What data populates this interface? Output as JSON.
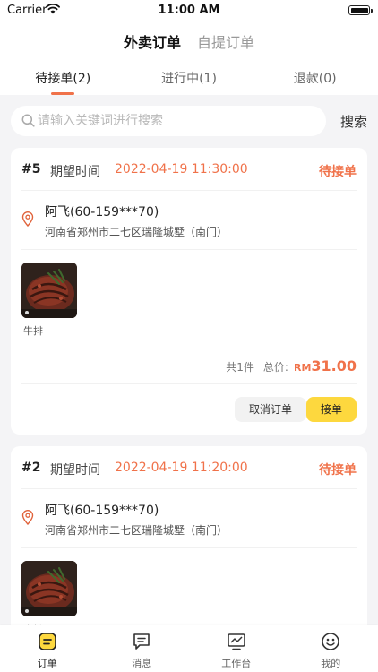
{
  "status_bar": {
    "carrier": "Carrier",
    "time": "11:00 AM"
  },
  "top_tabs": [
    {
      "label": "外卖订单",
      "active": true
    },
    {
      "label": "自提订单",
      "active": false
    }
  ],
  "sub_tabs": [
    {
      "label": "待接单(2)",
      "active": true
    },
    {
      "label": "进行中(1)",
      "active": false
    },
    {
      "label": "退款(0)",
      "active": false
    }
  ],
  "search": {
    "placeholder": "请输入关键词进行搜索",
    "button_label": "搜索"
  },
  "orders": [
    {
      "order_no": "#5",
      "expect_label": "期望时间",
      "expect_time": "2022-04-19 11:30:00",
      "status": "待接单",
      "customer": "阿飞(60-159***70)",
      "address": "河南省郑州市二七区瑞隆城墅（南门）",
      "item_name": "牛排",
      "qty_text": "共1件",
      "total_label": "总价:",
      "currency": "RM",
      "amount": "31.00",
      "cancel_label": "取消订单",
      "accept_label": "接单"
    },
    {
      "order_no": "#2",
      "expect_label": "期望时间",
      "expect_time": "2022-04-19 11:20:00",
      "status": "待接单",
      "customer": "阿飞(60-159***70)",
      "address": "河南省郑州市二七区瑞隆城墅（南门）",
      "item_name": "牛排"
    }
  ],
  "tabbar": [
    {
      "label": "订单",
      "icon": "order-icon",
      "active": true
    },
    {
      "label": "消息",
      "icon": "message-icon",
      "active": false
    },
    {
      "label": "工作台",
      "icon": "workbench-icon",
      "active": false
    },
    {
      "label": "我的",
      "icon": "profile-icon",
      "active": false
    }
  ],
  "colors": {
    "accent": "#f0724a",
    "accept_button": "#fdd83e",
    "background": "#f4f4f6"
  }
}
